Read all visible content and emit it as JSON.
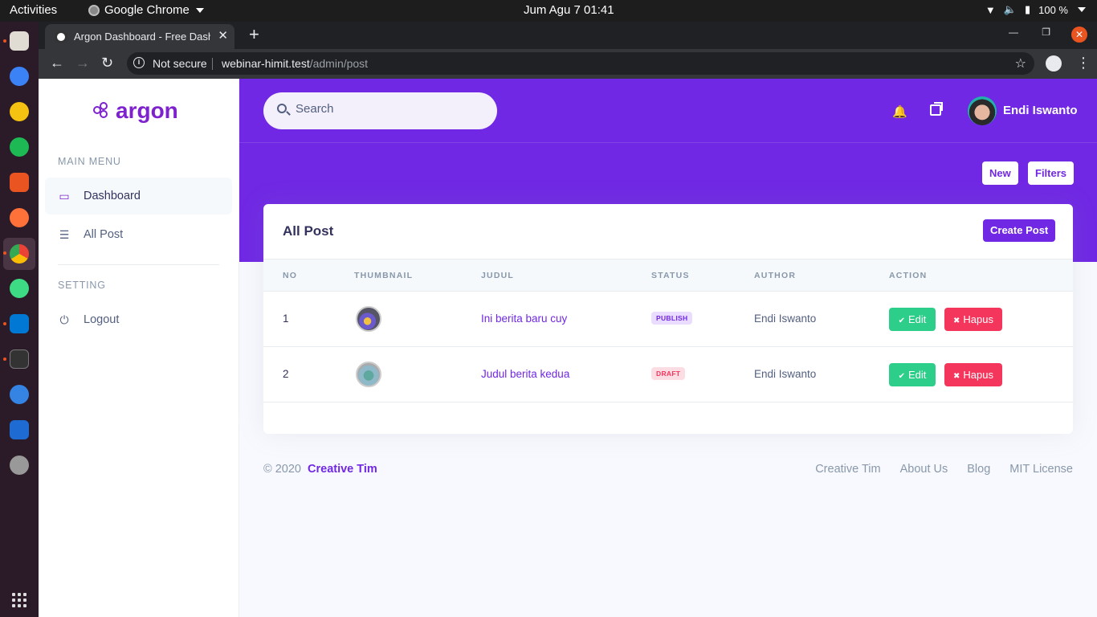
{
  "system": {
    "activities": "Activities",
    "app_name": "Google Chrome",
    "clock": "Jum Agu 7  01:41",
    "battery": "100 %"
  },
  "browser": {
    "tab_title": "Argon Dashboard - Free Dashboard",
    "security_label": "Not secure",
    "url_host": "webinar-himit.test",
    "url_path": "/admin/post"
  },
  "sidebar": {
    "brand": "argon",
    "main_menu_heading": "MAIN MENU",
    "items": [
      {
        "label": "Dashboard",
        "icon": "monitor-icon"
      },
      {
        "label": "All Post",
        "icon": "list-icon"
      }
    ],
    "setting_heading": "SETTING",
    "logout_label": "Logout"
  },
  "header": {
    "search_placeholder": "Search",
    "user_name": "Endi Iswanto",
    "new_label": "New",
    "filters_label": "Filters"
  },
  "card": {
    "title": "All Post",
    "create_label": "Create Post",
    "columns": [
      "NO",
      "THUMBNAIL",
      "JUDUL",
      "STATUS",
      "AUTHOR",
      "ACTION"
    ],
    "rows": [
      {
        "no": "1",
        "judul": "Ini berita baru cuy",
        "status": "PUBLISH",
        "author": "Endi Iswanto",
        "edit": "Edit",
        "hapus": "Hapus"
      },
      {
        "no": "2",
        "judul": "Judul berita kedua",
        "status": "DRAFT",
        "author": "Endi Iswanto",
        "edit": "Edit",
        "hapus": "Hapus"
      }
    ]
  },
  "footer": {
    "copyright": "© 2020",
    "brand_link": "Creative Tim",
    "links": [
      "Creative Tim",
      "About Us",
      "Blog",
      "MIT License"
    ]
  },
  "colors": {
    "primary": "#7028e4",
    "success": "#2dce89",
    "danger": "#f5365c"
  }
}
